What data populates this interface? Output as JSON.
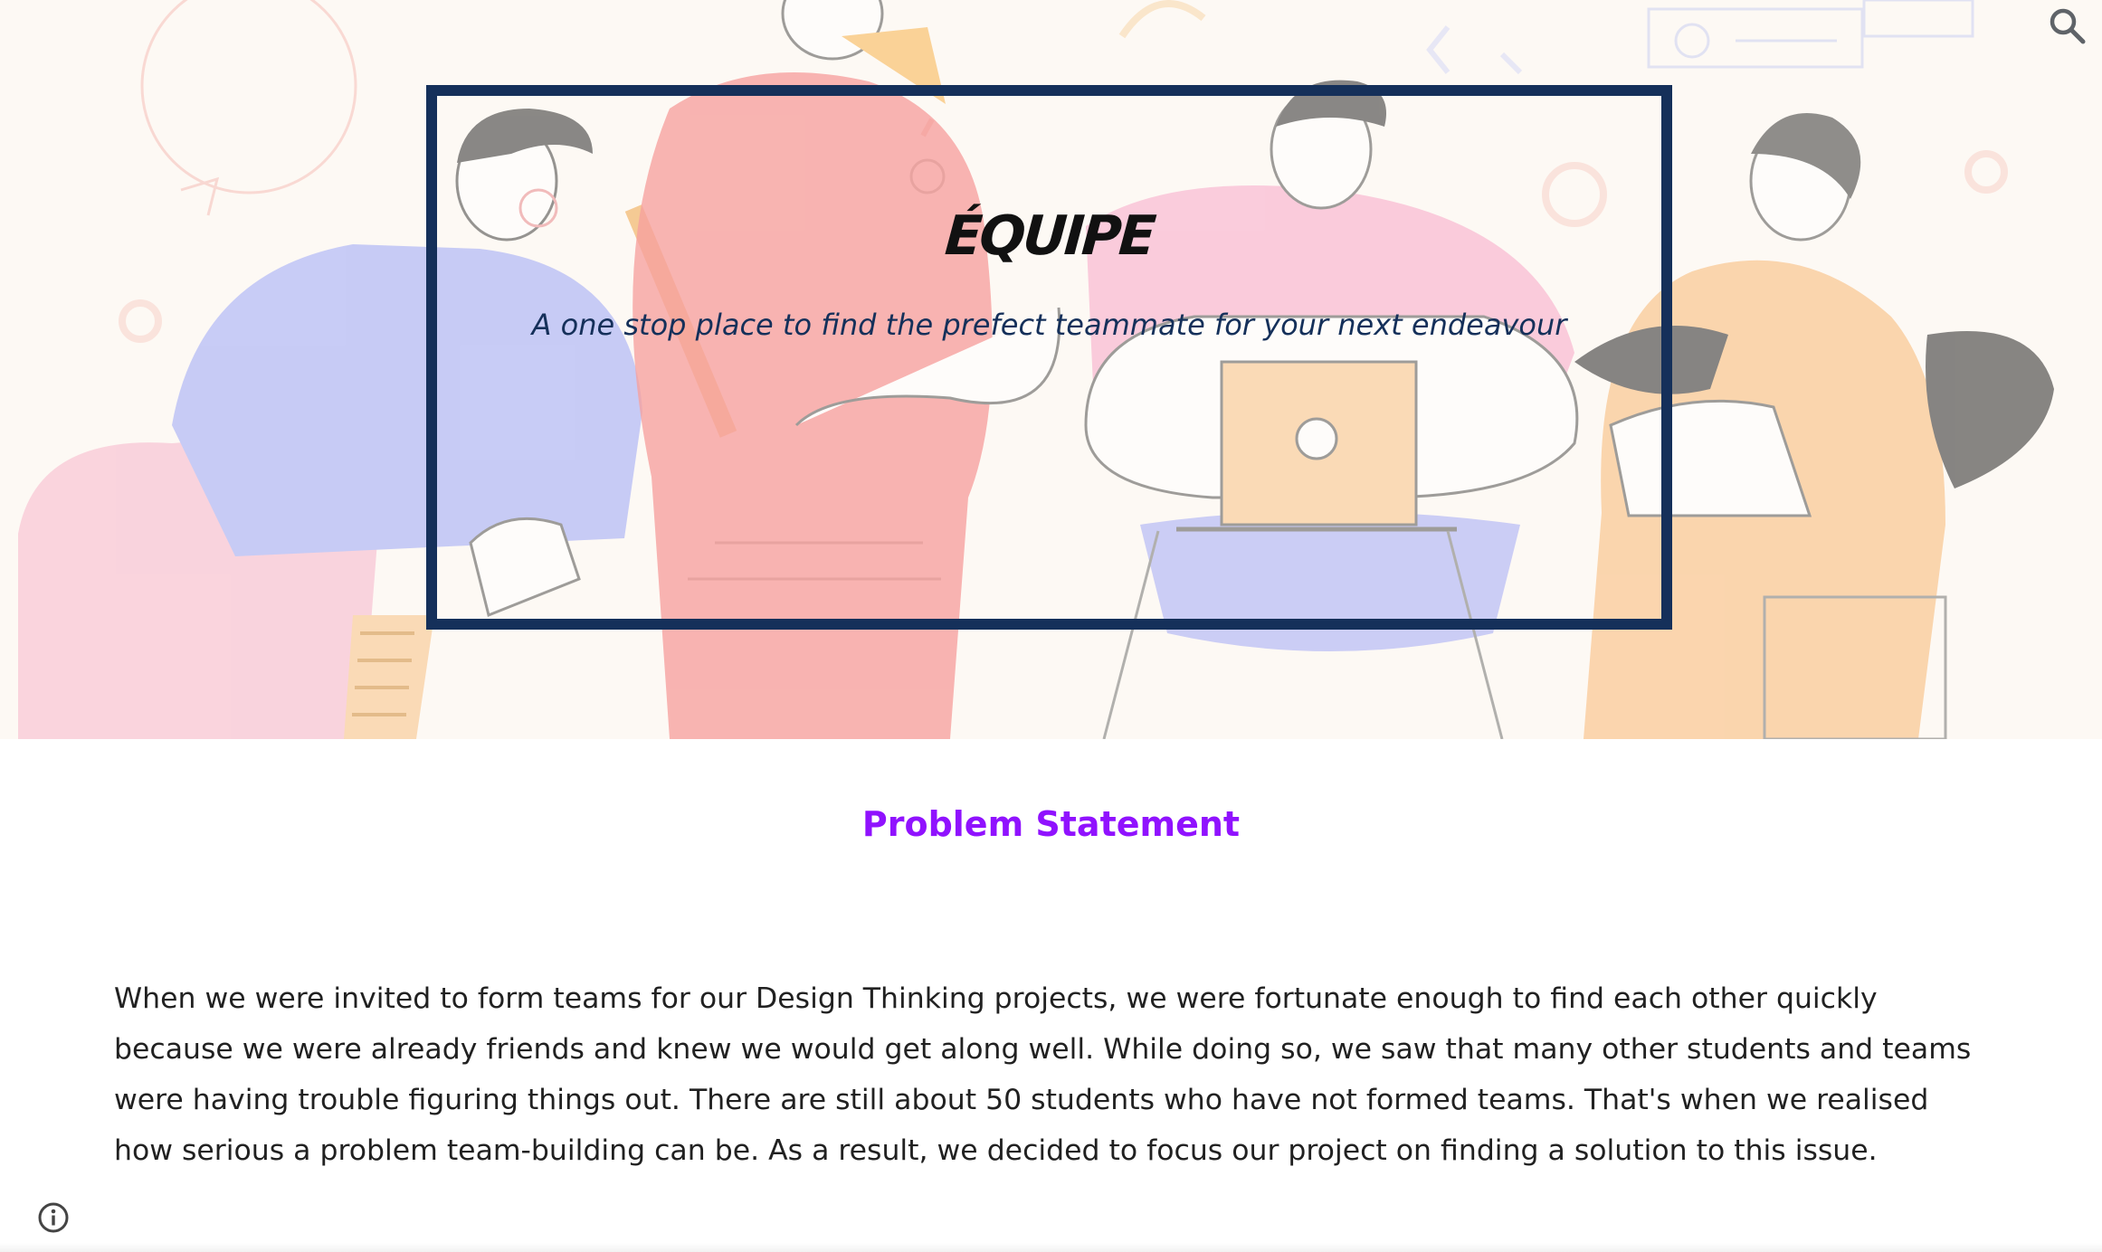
{
  "header": {
    "site_title": "ÉQUIPE",
    "tagline": "A one stop place to find the prefect teammate for your next endeavour",
    "search_icon": "search-icon"
  },
  "main": {
    "section_heading": "Problem Statement",
    "paragraph": "When we were invited to form teams for our Design Thinking projects, we were fortunate enough to find each other quickly because we were already friends and knew we would get along well. While doing so, we saw that many other students and teams were having trouble figuring things out. There are still about 50 students who have not formed teams. That's when we realised how serious a problem team-building can be. As a result, we decided to focus our project on finding a solution to this issue."
  },
  "footer": {
    "info_icon": "info-icon"
  },
  "colors": {
    "frame_border": "#15305a",
    "heading_accent": "#9012fe",
    "body_text": "#212121",
    "hero_background": "#fdf8f4"
  }
}
